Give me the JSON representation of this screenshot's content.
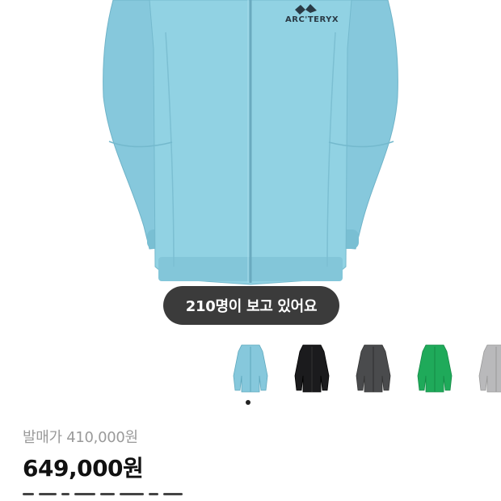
{
  "product": {
    "brand_logo_text": "ARC'TERYX",
    "viewers_badge": "210명이 보고 있어요",
    "retail_price_label": "발매가 410,000원",
    "sale_price": "649,000원"
  },
  "color_options": [
    {
      "name": "blue-jacket-thumb",
      "color": "#7fc3d6"
    },
    {
      "name": "black-jacket-thumb",
      "color": "#1b1b1d"
    },
    {
      "name": "grey-jacket-thumb",
      "color": "#4a4b4d"
    },
    {
      "name": "green-jacket-thumb",
      "color": "#1faa5a"
    },
    {
      "name": "light-grey-jacket-thumb",
      "color": "#b9b9bb"
    }
  ],
  "colors": {
    "jacket_main": "#8fd0e2",
    "jacket_shadow": "#6fb6cb",
    "badge_bg": "#3b3b3b",
    "price_muted": "#9a9a9a"
  },
  "carousel": {
    "active_index": 0
  }
}
